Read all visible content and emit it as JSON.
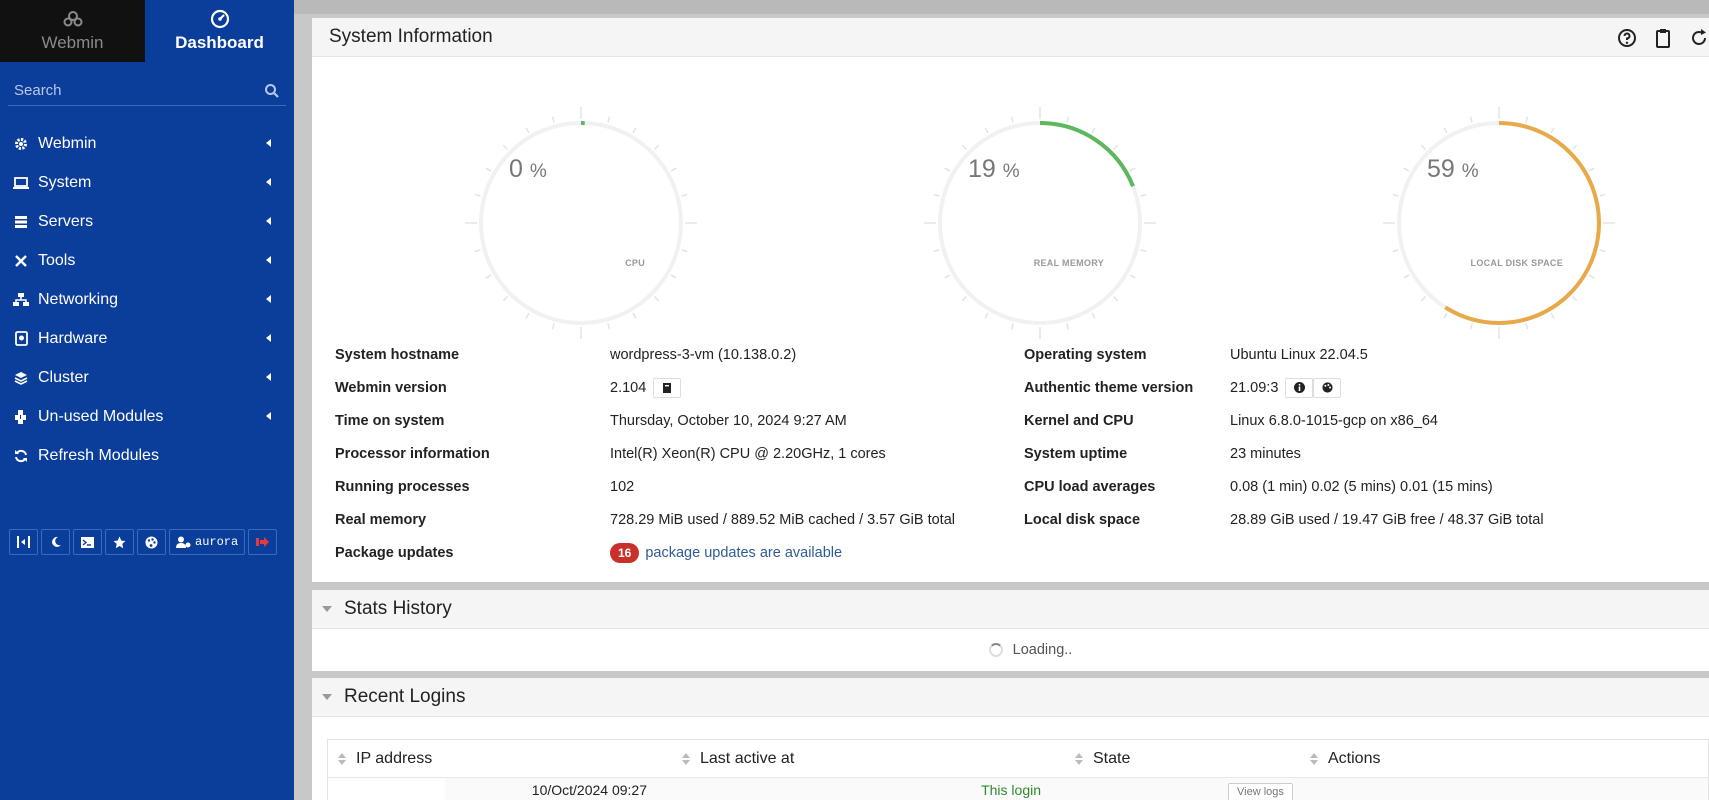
{
  "sidebar": {
    "tab_webmin": "Webmin",
    "tab_dashboard": "Dashboard",
    "search_placeholder": "Search",
    "menu": [
      {
        "label": "Webmin",
        "icon": "gear-icon"
      },
      {
        "label": "System",
        "icon": "laptop-icon"
      },
      {
        "label": "Servers",
        "icon": "server-icon"
      },
      {
        "label": "Tools",
        "icon": "tools-icon"
      },
      {
        "label": "Networking",
        "icon": "network-icon"
      },
      {
        "label": "Hardware",
        "icon": "hdd-icon"
      },
      {
        "label": "Cluster",
        "icon": "layers-icon"
      },
      {
        "label": "Un-used Modules",
        "icon": "puzzle-icon"
      },
      {
        "label": "Refresh Modules",
        "icon": "refresh-icon"
      }
    ],
    "user": "aurora"
  },
  "system_info": {
    "title": "System Information",
    "gauges": [
      {
        "label": "CPU",
        "value": 0,
        "unit": "%",
        "color": "#5cb85c"
      },
      {
        "label": "REAL MEMORY",
        "value": 19,
        "unit": "%",
        "color": "#5cb85c"
      },
      {
        "label": "LOCAL DISK SPACE",
        "value": 59,
        "unit": "%",
        "color": "#e8a94a"
      }
    ],
    "left": [
      {
        "k": "System hostname",
        "v": "wordpress-3-vm (10.138.0.2)"
      },
      {
        "k": "Webmin version",
        "v": "2.104"
      },
      {
        "k": "Time on system",
        "v": "Thursday, October 10, 2024 9:27 AM"
      },
      {
        "k": "Processor information",
        "v": "Intel(R) Xeon(R) CPU @ 2.20GHz, 1 cores"
      },
      {
        "k": "Running processes",
        "v": "102"
      },
      {
        "k": "Real memory",
        "v": "728.29 MiB used / 889.52 MiB cached / 3.57 GiB total"
      },
      {
        "k": "Package updates",
        "v": "package updates are available",
        "badge": "16"
      }
    ],
    "right": [
      {
        "k": "Operating system",
        "v": "Ubuntu Linux 22.04.5"
      },
      {
        "k": "Authentic theme version",
        "v": "21.09:3"
      },
      {
        "k": "Kernel and CPU",
        "v": "Linux 6.8.0-1015-gcp on x86_64"
      },
      {
        "k": "System uptime",
        "v": "23 minutes"
      },
      {
        "k": "CPU load averages",
        "v": "0.08 (1 min) 0.02 (5 mins) 0.01 (15 mins)"
      },
      {
        "k": "Local disk space",
        "v": "28.89 GiB used / 19.47 GiB free / 48.37 GiB total"
      }
    ]
  },
  "stats": {
    "title": "Stats History",
    "loading": "Loading.."
  },
  "logins": {
    "title": "Recent Logins",
    "columns": [
      "IP address",
      "Last active at",
      "State",
      "Actions"
    ],
    "row": {
      "last_active": "10/Oct/2024 09:27",
      "state": "This login",
      "action": "View logs"
    }
  }
}
